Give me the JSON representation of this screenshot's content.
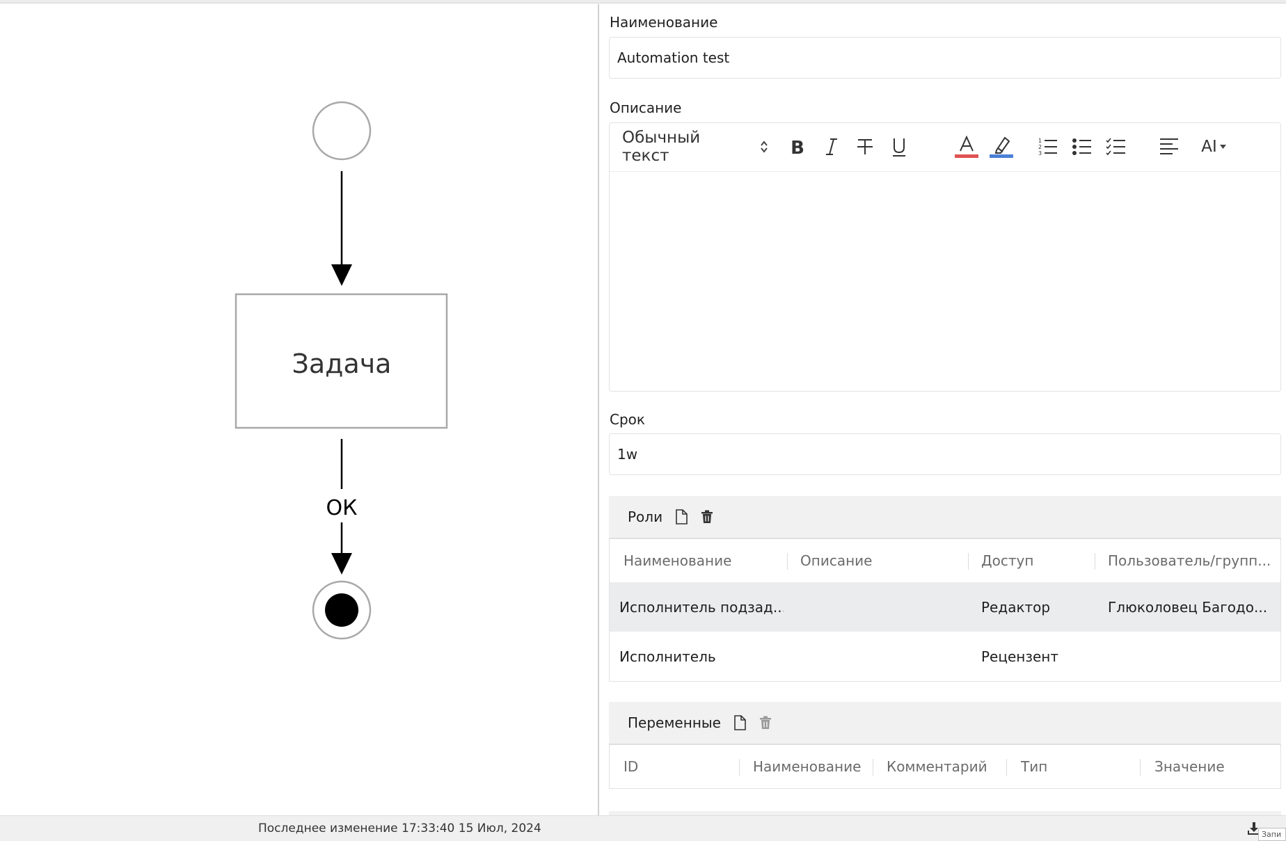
{
  "diagram": {
    "task_label": "Задача",
    "flow_label": "ОК"
  },
  "form": {
    "name_label": "Наименование",
    "name_value": "Automation test",
    "description_label": "Описание",
    "editor": {
      "text_style": "Обычный текст",
      "ai_label": "AI",
      "font_color": "#e05252",
      "highlight_color": "#4a7fd6"
    },
    "deadline_label": "Срок",
    "deadline_value": "1w"
  },
  "roles": {
    "title": "Роли",
    "columns": [
      "Наименование",
      "Описание",
      "Доступ",
      "Пользователь/групп..."
    ],
    "rows": [
      {
        "name": "Исполнитель подзад...",
        "description": "",
        "access": "Редактор",
        "user": "Глюколовец Багодо..."
      },
      {
        "name": "Исполнитель",
        "description": "",
        "access": "Рецензент",
        "user": ""
      }
    ]
  },
  "variables": {
    "title": "Переменные",
    "columns": [
      "ID",
      "Наименование",
      "Комментарий",
      "Тип",
      "Значение"
    ]
  },
  "footer": {
    "last_modified": "Последнее изменение 17:33:40 15 Июл, 2024",
    "tooltip_fragment": "Запи"
  }
}
